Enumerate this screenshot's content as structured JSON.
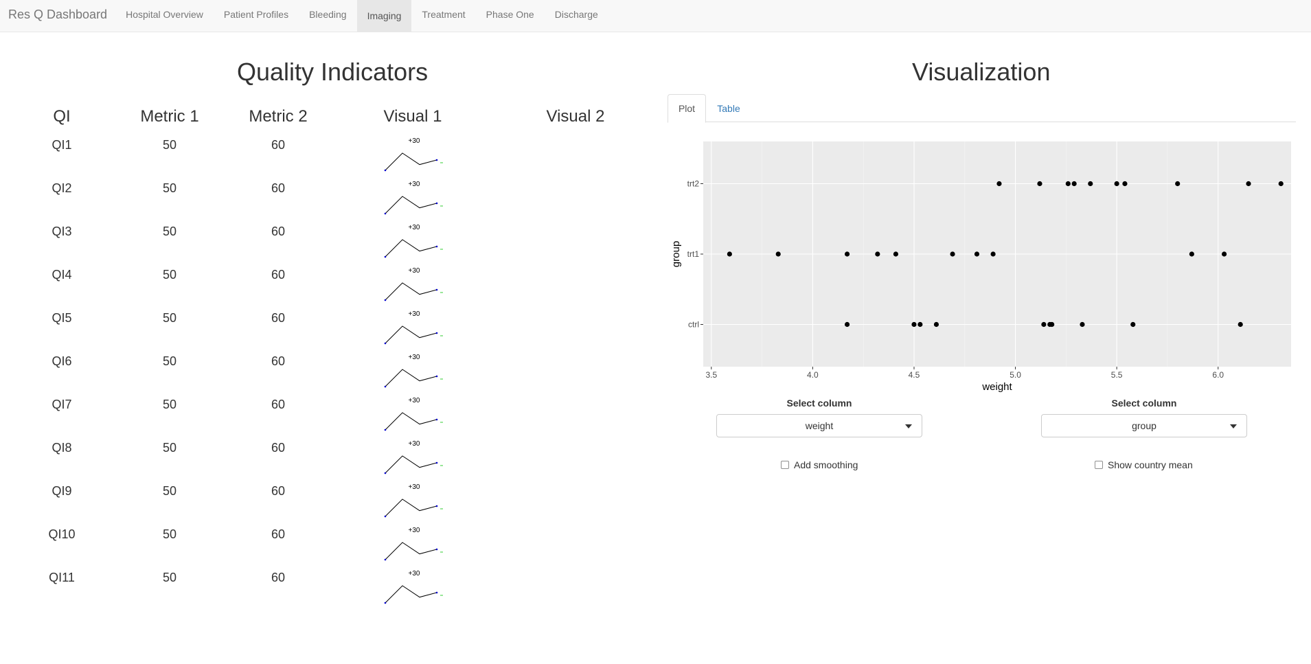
{
  "navbar": {
    "brand": "Res Q Dashboard",
    "items": [
      {
        "label": "Hospital Overview",
        "active": false
      },
      {
        "label": "Patient Profiles",
        "active": false
      },
      {
        "label": "Bleeding",
        "active": false
      },
      {
        "label": "Imaging",
        "active": true
      },
      {
        "label": "Treatment",
        "active": false
      },
      {
        "label": "Phase One",
        "active": false
      },
      {
        "label": "Discharge",
        "active": false
      }
    ]
  },
  "quality_indicators": {
    "title": "Quality Indicators",
    "columns": [
      "QI",
      "Metric 1",
      "Metric 2",
      "Visual 1",
      "Visual 2"
    ],
    "rows": [
      {
        "qi": "QI1",
        "metric1": "50",
        "metric2": "60",
        "spark_label": "+30"
      },
      {
        "qi": "QI2",
        "metric1": "50",
        "metric2": "60",
        "spark_label": "+30"
      },
      {
        "qi": "QI3",
        "metric1": "50",
        "metric2": "60",
        "spark_label": "+30"
      },
      {
        "qi": "QI4",
        "metric1": "50",
        "metric2": "60",
        "spark_label": "+30"
      },
      {
        "qi": "QI5",
        "metric1": "50",
        "metric2": "60",
        "spark_label": "+30"
      },
      {
        "qi": "QI6",
        "metric1": "50",
        "metric2": "60",
        "spark_label": "+30"
      },
      {
        "qi": "QI7",
        "metric1": "50",
        "metric2": "60",
        "spark_label": "+30"
      },
      {
        "qi": "QI8",
        "metric1": "50",
        "metric2": "60",
        "spark_label": "+30"
      },
      {
        "qi": "QI9",
        "metric1": "50",
        "metric2": "60",
        "spark_label": "+30"
      },
      {
        "qi": "QI10",
        "metric1": "50",
        "metric2": "60",
        "spark_label": "+30"
      },
      {
        "qi": "QI11",
        "metric1": "50",
        "metric2": "60",
        "spark_label": "+30"
      }
    ],
    "sparkline": {
      "values": [
        0,
        30,
        10,
        18
      ],
      "line_color": "#000000",
      "marker_color": "#0000cc",
      "end_color": "#33cc33"
    }
  },
  "visualization": {
    "title": "Visualization",
    "tabs": [
      {
        "label": "Plot",
        "active": true
      },
      {
        "label": "Table",
        "active": false
      }
    ],
    "controls": {
      "x_select": {
        "label": "Select column",
        "value": "weight"
      },
      "y_select": {
        "label": "Select column",
        "value": "group"
      },
      "smoothing": {
        "label": "Add smoothing",
        "checked": false
      },
      "country_mean": {
        "label": "Show country mean",
        "checked": false
      }
    }
  },
  "chart_data": {
    "type": "scatter",
    "title": "",
    "xlabel": "weight",
    "ylabel": "group",
    "xlim": [
      3.46,
      6.36
    ],
    "x_ticks": [
      "3.5",
      "4.0",
      "4.5",
      "5.0",
      "5.5",
      "6.0"
    ],
    "categories": [
      "ctrl",
      "trt1",
      "trt2"
    ],
    "panel_color": "#ebebeb",
    "grid": true,
    "series": [
      {
        "category": "trt2",
        "x": [
          4.92,
          5.12,
          5.26,
          5.29,
          5.37,
          5.5,
          5.54,
          5.8,
          6.15,
          6.31
        ]
      },
      {
        "category": "trt1",
        "x": [
          3.59,
          3.83,
          4.17,
          4.32,
          4.41,
          4.69,
          4.81,
          4.89,
          5.87,
          6.03
        ]
      },
      {
        "category": "ctrl",
        "x": [
          4.17,
          4.5,
          4.53,
          4.61,
          5.14,
          5.17,
          5.18,
          5.33,
          5.58,
          6.11
        ]
      }
    ]
  }
}
